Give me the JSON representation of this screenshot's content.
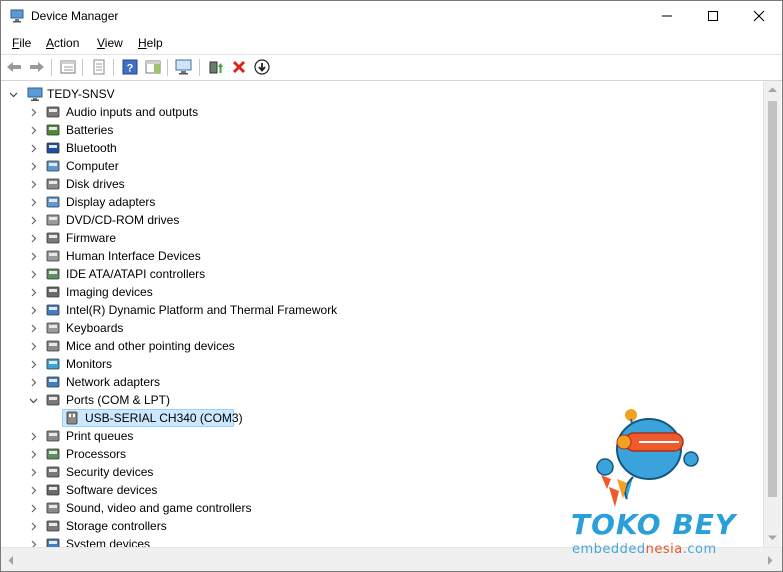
{
  "window": {
    "title": "Device Manager"
  },
  "menubar": {
    "items": [
      {
        "label": "File",
        "u": "F",
        "rest": "ile"
      },
      {
        "label": "Action",
        "u": "A",
        "rest": "ction"
      },
      {
        "label": "View",
        "u": "V",
        "rest": "iew"
      },
      {
        "label": "Help",
        "u": "H",
        "rest": "elp"
      }
    ]
  },
  "tree": {
    "root": "TEDY-SNSV",
    "categories": [
      "Audio inputs and outputs",
      "Batteries",
      "Bluetooth",
      "Computer",
      "Disk drives",
      "Display adapters",
      "DVD/CD-ROM drives",
      "Firmware",
      "Human Interface Devices",
      "IDE ATA/ATAPI controllers",
      "Imaging devices",
      "Intel(R) Dynamic Platform and Thermal Framework",
      "Keyboards",
      "Mice and other pointing devices",
      "Monitors",
      "Network adapters",
      "Ports (COM & LPT)",
      "Print queues",
      "Processors",
      "Security devices",
      "Software devices",
      "Sound, video and game controllers",
      "Storage controllers",
      "System devices"
    ],
    "ports_child": "USB-SERIAL CH340 (COM3)"
  },
  "watermark": {
    "brand": "TOKO BEY",
    "site_a": "embedded",
    "site_b": "nesia",
    "site_c": ".com"
  },
  "colors": {
    "selection": "#cce8ff",
    "brand": "#2a9fd8",
    "accent": "#e35a2b"
  },
  "icons": {
    "titlebar": "device-manager-icon",
    "toolbar": [
      "back-arrow-icon",
      "forward-arrow-icon",
      "properties-list-icon",
      "print-icon",
      "help-icon",
      "action-panel-icon",
      "scan-hardware-icon",
      "update-driver-icon",
      "uninstall-icon",
      "disable-device-icon"
    ]
  }
}
